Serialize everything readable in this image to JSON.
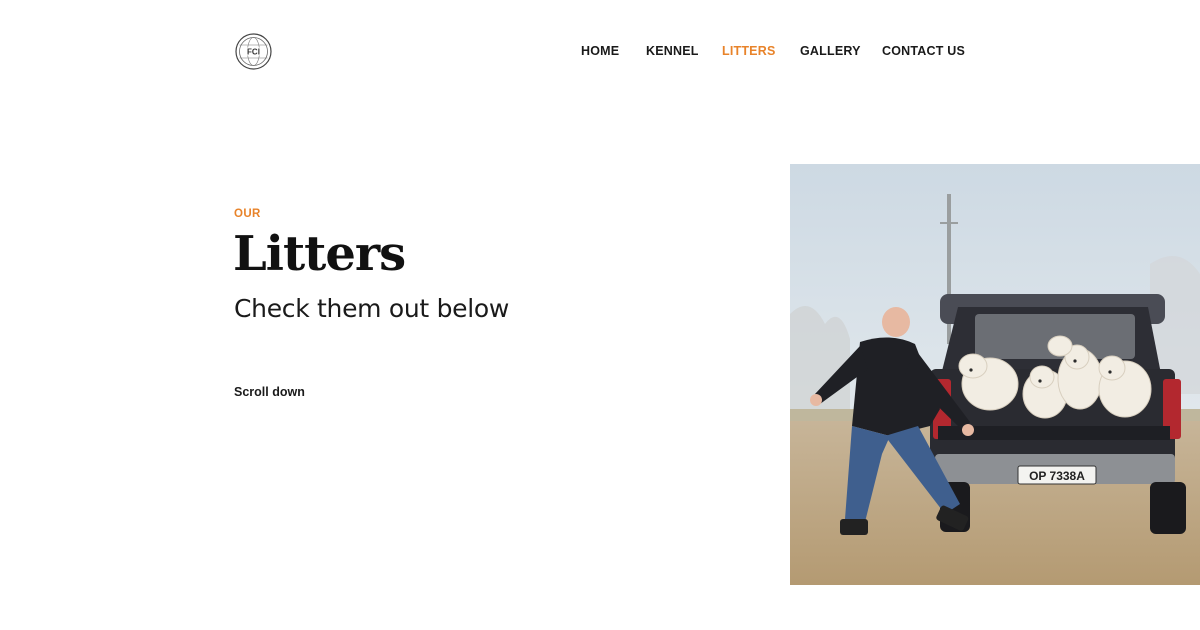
{
  "logo": {
    "text": "FCI",
    "icon": "fci-globe-logo"
  },
  "nav": {
    "items": [
      {
        "label": "HOME",
        "active": false
      },
      {
        "label": "KENNEL",
        "active": false
      },
      {
        "label": "LITTERS",
        "active": true
      },
      {
        "label": "GALLERY",
        "active": false
      },
      {
        "label": "CONTACT US",
        "active": false
      }
    ]
  },
  "hero": {
    "eyebrow": "OUR",
    "title": "Litters",
    "subtitle": "Check them out below",
    "scroll_label": "Scroll down"
  },
  "photo": {
    "plate": "OP 7338A"
  },
  "colors": {
    "accent": "#e8832a",
    "text": "#111111",
    "background": "#ffffff"
  }
}
